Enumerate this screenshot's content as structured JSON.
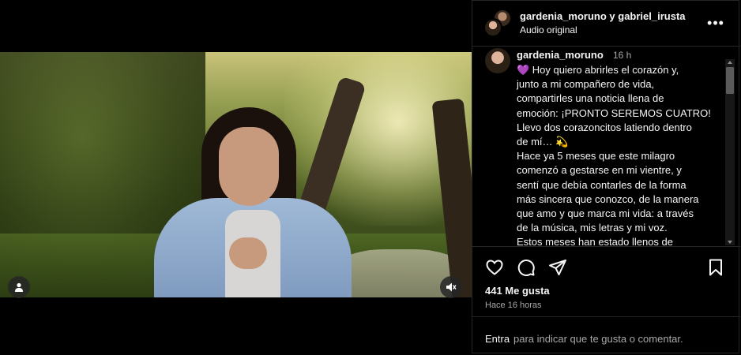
{
  "header": {
    "names": "gardenia_moruno y gabriel_irusta",
    "subtitle": "Audio original",
    "more_label": "•••"
  },
  "caption": {
    "username": "gardenia_moruno",
    "time": "16 h",
    "text": "💜 Hoy quiero abrirles el corazón y,\njunto a mi compañero de vida,\ncompartirles una noticia llena de\nemoción: ¡PRONTO SEREMOS CUATRO!\nLlevo dos corazoncitos latiendo dentro\nde mí… 💫\nHace ya 5 meses que este milagro\ncomenzó a gestarse en mi vientre, y\nsentí que debía contarles de la forma\nmás sincera que conozco, de la manera\nque amo y que marca mi vida: a través\nde la música, mis letras y mi voz.\nEstos meses han estado llenos de"
  },
  "actions": {
    "icons": [
      "heart-icon",
      "comment-icon",
      "share-icon",
      "bookmark-icon"
    ],
    "likes": "441 Me gusta",
    "ago": "Hace 16 horas"
  },
  "comment": {
    "enter_label": "Entra",
    "placeholder_rest": "para indicar que te gusta o comentar."
  },
  "media": {
    "icons": [
      "user-icon",
      "muted-speaker-icon"
    ]
  },
  "colors": {
    "background": "#000000",
    "border": "#262626",
    "text": "#f5f5f5",
    "secondary_text": "#a8a8a8"
  }
}
